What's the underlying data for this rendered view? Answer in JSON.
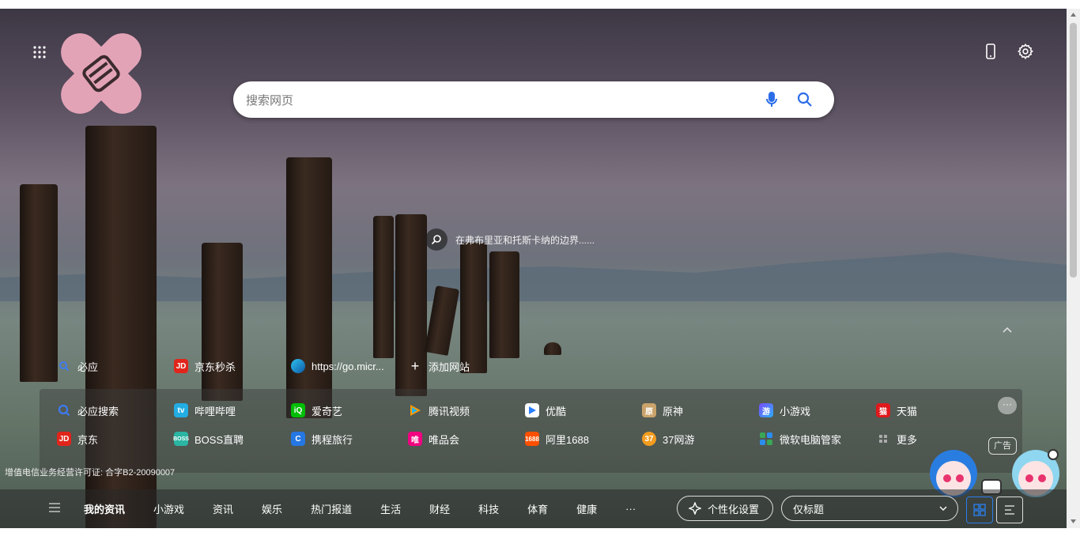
{
  "search": {
    "placeholder": "搜索网页"
  },
  "caption": {
    "text": "在弗布里亚和托斯卡纳的边界......"
  },
  "quick_links": [
    {
      "label": "必应",
      "icon": "bing-search-icon"
    },
    {
      "label": "京东秒杀",
      "icon": "jd-icon"
    },
    {
      "label": "https://go.micr...",
      "icon": "edge-icon"
    },
    {
      "label": "添加网站",
      "icon": "plus-icon"
    }
  ],
  "sites": [
    {
      "label": "必应搜索",
      "color": "#2b6de8"
    },
    {
      "label": "哔哩哔哩",
      "color": "#23ade5"
    },
    {
      "label": "爱奇艺",
      "color": "#00be06"
    },
    {
      "label": "腾讯视频",
      "color": "#ff7a00"
    },
    {
      "label": "优酷",
      "color": "#2a7fff"
    },
    {
      "label": "原神",
      "color": "#c9a36b"
    },
    {
      "label": "小游戏",
      "color": "#7a4cff"
    },
    {
      "label": "天猫",
      "color": "#e0191c"
    },
    {
      "label": "京东",
      "color": "#e1251b"
    },
    {
      "label": "BOSS直聘",
      "color": "#2bb5a3"
    },
    {
      "label": "携程旅行",
      "color": "#2577e3"
    },
    {
      "label": "唯品会",
      "color": "#f10180"
    },
    {
      "label": "阿里1688",
      "color": "#ff5000"
    },
    {
      "label": "37网游",
      "color": "#f29c1f"
    },
    {
      "label": "微软电脑管家",
      "color": "#3aa757"
    },
    {
      "label": "更多",
      "color": "#888888"
    }
  ],
  "ad_label": "广告",
  "license": "增值电信业务经营许可证: 合字B2-20090007",
  "nav_tabs": [
    {
      "label": "我的资讯",
      "active": true
    },
    {
      "label": "小游戏"
    },
    {
      "label": "资讯"
    },
    {
      "label": "娱乐"
    },
    {
      "label": "热门报道"
    },
    {
      "label": "生活"
    },
    {
      "label": "财经"
    },
    {
      "label": "科技"
    },
    {
      "label": "体育"
    },
    {
      "label": "健康"
    },
    {
      "label": "···"
    }
  ],
  "personalize_label": "个性化设置",
  "layout_select_value": "仅标题"
}
